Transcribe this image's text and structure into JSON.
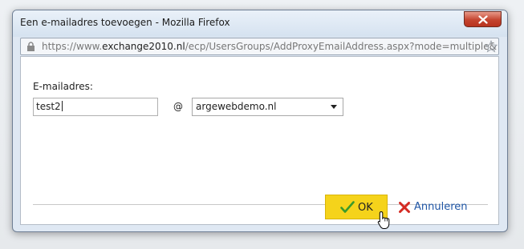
{
  "window": {
    "title": "Een e-mailadres toevoegen - Mozilla Firefox"
  },
  "urlbar": {
    "prefix": "https://www.",
    "domain": "exchange2010.nl",
    "path": "/ecp/UsersGroups/AddProxyEmailAddress.aspx?mode=multiple&"
  },
  "form": {
    "label": "E-mailadres:",
    "local_part_value": "test2",
    "at_sign": "@",
    "domain_selected": "argewebdemo.nl"
  },
  "buttons": {
    "ok_label": "OK",
    "cancel_label": "Annuleren"
  },
  "colors": {
    "ok_background": "#f5d31b",
    "cancel_text": "#1f56a6",
    "close_button": "#c4442f"
  },
  "icons": [
    "lock-icon",
    "star-icon",
    "close-icon",
    "chevron-down-icon",
    "checkmark-icon",
    "cancel-x-icon",
    "hand-cursor-icon"
  ]
}
